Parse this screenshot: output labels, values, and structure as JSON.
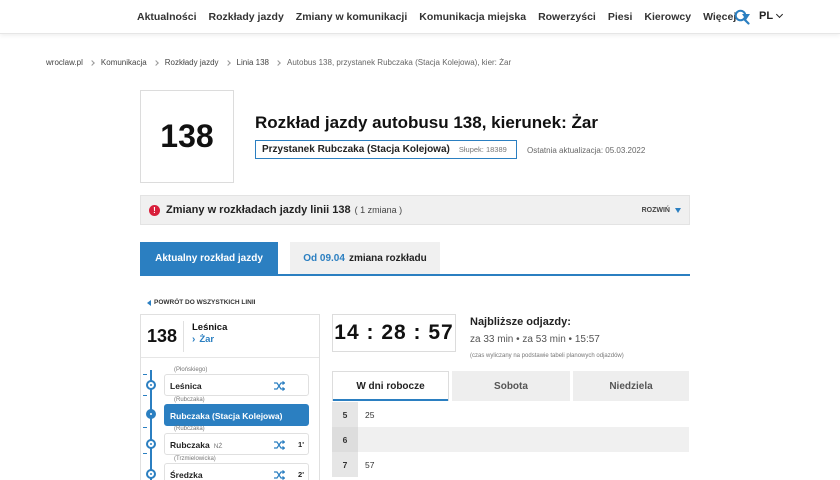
{
  "nav": {
    "items": [
      "Aktualności",
      "Rozkłady jazdy",
      "Zmiany w komunikacji",
      "Komunikacja miejska",
      "Rowerzyści",
      "Piesi",
      "Kierowcy"
    ],
    "more_label": "Więcej",
    "language": "PL"
  },
  "breadcrumb": [
    "wroclaw.pl",
    "Komunikacja",
    "Rozkłady jazdy",
    "Linia 138",
    "Autobus 138, przystanek Rubczaka (Stacja Kolejowa), kier: Żar"
  ],
  "header": {
    "line_number": "138",
    "title": "Rozkład jazdy autobusu 138, kierunek: Żar",
    "stop_name": "Przystanek Rubczaka (Stacja Kolejowa)",
    "stop_post": "Słupek: 18389",
    "last_update": "Ostatnia aktualizacja: 05.03.2022"
  },
  "changes": {
    "icon": "!",
    "title": "Zmiany w rozkładach jazdy linii 138",
    "count": "( 1 zmiana )",
    "expand_label": "ROZWIŃ"
  },
  "schedule_tabs": {
    "current": "Aktualny rozkład jazdy",
    "next_date": "Od 09.04",
    "next_rest": "zmiana rozkładu"
  },
  "back_link": "POWRÓT DO WSZYSTKICH LINII",
  "route": {
    "line": "138",
    "from": "Leśnica",
    "to_arrow": "›",
    "to": "Żar",
    "stops": [
      {
        "area": "(Płońskiego)",
        "name": "Leśnica",
        "extra": "",
        "minutes": "",
        "active": false
      },
      {
        "area": "(Rubczaka)",
        "name": "Rubczaka (Stacja Kolejowa)",
        "extra": "",
        "minutes": "",
        "active": true
      },
      {
        "area": "(Rubczaka)",
        "name": "Rubczaka",
        "extra": "NŻ",
        "minutes": "1'",
        "active": false
      },
      {
        "area": "(Trzmielowicka)",
        "name": "Średzka",
        "extra": "",
        "minutes": "2'",
        "active": false
      }
    ]
  },
  "clock": {
    "time": "14 : 28 : 57"
  },
  "next_departures": {
    "title": "Najbliższe odjazdy:",
    "times": "za 33 min • za 53 min • 15:57",
    "note": "(czas wyliczany na podstawie tabeli planowych odjazdów)"
  },
  "day_tabs": [
    "W dni robocze",
    "Sobota",
    "Niedziela"
  ],
  "timetable": [
    {
      "hour": "5",
      "minutes": "25"
    },
    {
      "hour": "6",
      "minutes": ""
    },
    {
      "hour": "7",
      "minutes": "57"
    }
  ],
  "colors": {
    "accent": "#2b7fc1",
    "warning": "#d81f3b"
  }
}
